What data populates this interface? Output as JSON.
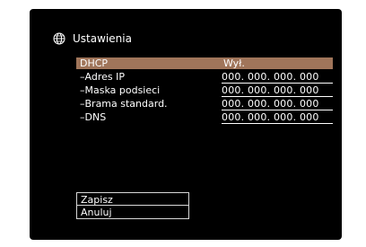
{
  "colors": {
    "screen_bg": "#000000",
    "selected_row": "#a0755a",
    "text": "#ffffff"
  },
  "header": {
    "icon": "globe-icon",
    "title": "Ustawienia"
  },
  "rows": [
    {
      "label": "DHCP",
      "value": "Wył."
    },
    {
      "label": "–Adres IP",
      "value": "000. 000. 000. 000"
    },
    {
      "label": "–Maska podsieci",
      "value": "000. 000. 000. 000"
    },
    {
      "label": "–Brama standard.",
      "value": "000. 000. 000. 000"
    },
    {
      "label": "–DNS",
      "value": "000. 000. 000. 000"
    }
  ],
  "buttons": {
    "save": "Zapisz",
    "cancel": "Anuluj"
  }
}
